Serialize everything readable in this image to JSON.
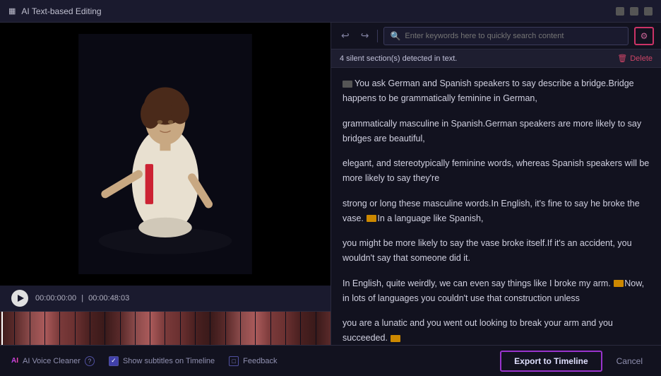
{
  "titleBar": {
    "title": "AI Text-based Editing",
    "controls": [
      "minimize",
      "maximize",
      "close"
    ]
  },
  "toolbar": {
    "undo_label": "↩",
    "redo_label": "↪",
    "search_placeholder": "Enter keywords here to quickly search content",
    "filter_icon": "≡≡"
  },
  "notification": {
    "text": "4 silent section(s) detected in text.",
    "delete_label": "Delete",
    "delete_icon": "🗑"
  },
  "textContent": {
    "paragraphs": [
      "You ask German and Spanish speakers to say describe a bridge.Bridge happens to be grammatically feminine in German,",
      "grammatically masculine in Spanish.German speakers are more likely to say bridges are beautiful,",
      "elegant, and stereotypically feminine words, whereas Spanish speakers will be more likely to say they're",
      "strong or long these masculine words.In English, it's fine to say he broke the vase. In a language like Spanish,",
      "you might be more likely to say the vase broke itself.If it's an accident, you wouldn't say that someone did it.",
      "In English, quite weirdly, we can even say things like I broke my arm. Now, in lots of languages you couldn't use that construction unless",
      "you are a lunatic and you went out looking to break your arm and you succeeded. "
    ],
    "silent_indices": [
      3,
      6
    ]
  },
  "videoControls": {
    "current_time": "00:00:00:00",
    "total_time": "00:00:48:03",
    "separator": "|"
  },
  "bottomBar": {
    "ai_voice_cleaner": "AI Voice Cleaner",
    "show_subtitles": "Show subtitles on Timeline",
    "feedback": "Feedback",
    "export_btn": "Export to Timeline",
    "cancel_btn": "Cancel"
  },
  "colors": {
    "accent_purple": "#9933cc",
    "accent_red": "#cc3366",
    "silent_orange": "#cc8800",
    "bg_dark": "#1a1a2e"
  }
}
